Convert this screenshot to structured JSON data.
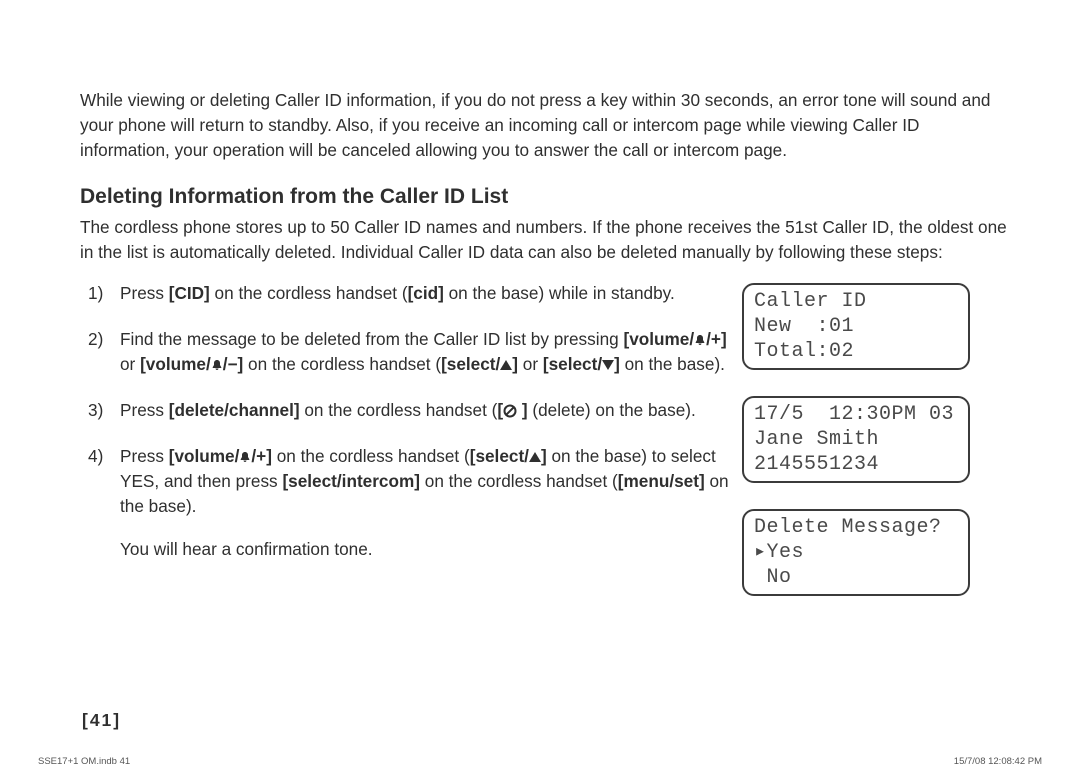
{
  "intro": "While viewing or deleting Caller ID information, if you do not press a key within 30 seconds, an error tone will sound and your phone will return to standby. Also, if you receive an incoming call or intercom page while viewing Caller ID information, your operation will be canceled allowing you to answer the call or intercom page.",
  "heading": "Deleting Information from the Caller ID List",
  "desc": "The cordless phone stores up to 50 Caller ID names and numbers. If the phone receives the 51st Caller ID, the oldest one in the list is automatically deleted. Individual Caller ID data can also be deleted manually by following these steps:",
  "steps": {
    "s1_a": "Press ",
    "s1_b": "[CID]",
    "s1_c": " on the cordless handset (",
    "s1_d": "[cid]",
    "s1_e": " on the base) while in standby.",
    "s2_a": "Find the message to be deleted from the Caller ID list by pressing ",
    "s2_b": "[volume/",
    "s2_c": "/+]",
    "s2_d": " or ",
    "s2_e": "[volume/",
    "s2_f": "/−]",
    "s2_g": " on the cordless handset (",
    "s2_h": "[select/",
    "s2_i": "]",
    "s2_j": " or ",
    "s2_k": "[select/",
    "s2_l": "]",
    "s2_m": " on the base).",
    "s3_a": "Press ",
    "s3_b": "[delete/channel]",
    "s3_c": " on the cordless handset (",
    "s3_d": "[",
    "s3_e": "]",
    "s3_f": " (delete) on the base).",
    "s4_a": "Press ",
    "s4_b": "[volume/",
    "s4_c": "/+]",
    "s4_d": " on the cordless handset (",
    "s4_e": "[select/",
    "s4_f": "]",
    "s4_g": " on the base) to select YES, and then press ",
    "s4_h": "[select/intercom]",
    "s4_i": " on the cordless handset (",
    "s4_j": "[menu/set]",
    "s4_k": " on the base).",
    "confirm": "You will hear a confirmation tone."
  },
  "lcd1": {
    "l1": "Caller ID",
    "l2": "New  :01",
    "l3": "Total:02"
  },
  "lcd2": {
    "l1": "17/5  12:30PM 03",
    "l2": "Jane Smith",
    "l3": "2145551234"
  },
  "lcd3": {
    "l1": "Delete Message?",
    "l2": "▸Yes",
    "l3": " No"
  },
  "pagenum": "[41]",
  "footer_left": "SSE17+1 OM.indb   41",
  "footer_right": "15/7/08   12:08:42 PM"
}
